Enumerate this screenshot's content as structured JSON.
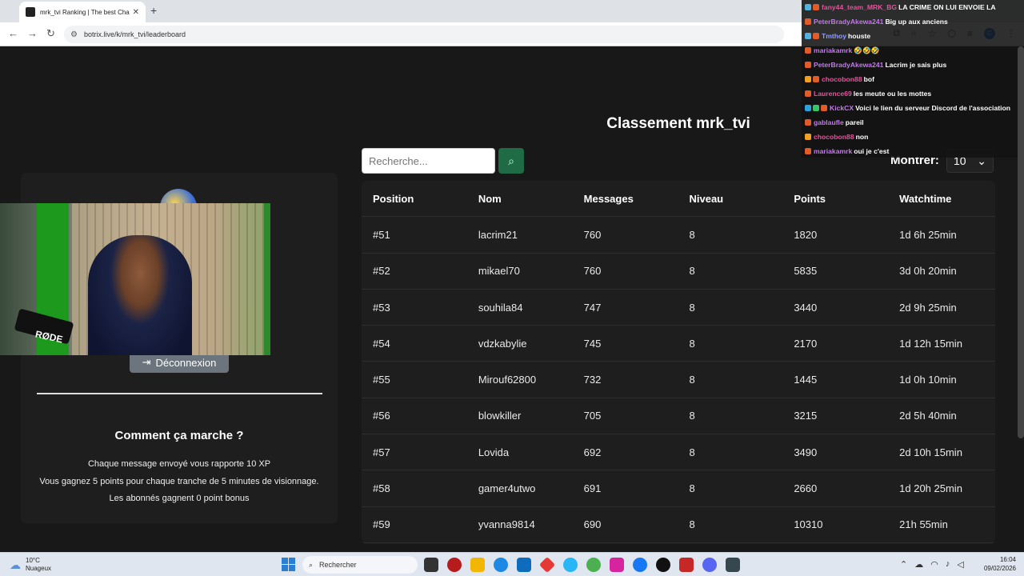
{
  "browser": {
    "tab_title": "mrk_tvi Ranking | The best Chat",
    "tab_close": "✕",
    "new_tab": "+",
    "url": "botrix.live/k/mrk_tvi/leaderboard",
    "profile_initial": "C"
  },
  "page": {
    "title": "Classement mrk_tvi",
    "search_placeholder": "Recherche...",
    "show_label": "Montrer:",
    "show_value": "10",
    "table": {
      "headers": [
        "Position",
        "Nom",
        "Messages",
        "Niveau",
        "Points",
        "Watchtime"
      ],
      "rows": [
        [
          "#51",
          "lacrim21",
          "760",
          "8",
          "1820",
          "1d 6h 25min"
        ],
        [
          "#52",
          "mikael70",
          "760",
          "8",
          "5835",
          "3d 0h 20min"
        ],
        [
          "#53",
          "souhila84",
          "747",
          "8",
          "3440",
          "2d 9h 25min"
        ],
        [
          "#54",
          "vdzkabylie",
          "745",
          "8",
          "2170",
          "1d 12h 15min"
        ],
        [
          "#55",
          "Mirouf62800",
          "732",
          "8",
          "1445",
          "1d 0h 10min"
        ],
        [
          "#56",
          "blowkiller",
          "705",
          "8",
          "3215",
          "2d 5h 40min"
        ],
        [
          "#57",
          "Lovida",
          "692",
          "8",
          "3490",
          "2d 10h 15min"
        ],
        [
          "#58",
          "gamer4utwo",
          "691",
          "8",
          "2660",
          "1d 20h 25min"
        ],
        [
          "#59",
          "yvanna9814",
          "690",
          "8",
          "10310",
          "21h 55min"
        ]
      ]
    }
  },
  "left_panel": {
    "logout_label": "Déconnexion",
    "how_title": "Comment ça marche ?",
    "how_lines": [
      "Chaque message envoyé vous rapporte 10 XP",
      "Vous gagnez 5 points pour chaque tranche de 5 minutes de visionnage.",
      "Les abonnés gagnent 0 point bonus"
    ]
  },
  "webcam": {
    "mic_brand": "RØDE"
  },
  "chat": [
    {
      "user": "fany44_team_MRK_BG",
      "color": "#e0559a",
      "msg": "LA CRIME ON LUI ENVOIE LA"
    },
    {
      "user": "PeterBradyAkewa241",
      "color": "#c07be6",
      "msg": "Big up aux anciens"
    },
    {
      "user": "Tmthoy",
      "color": "#8f9cff",
      "msg": "houste"
    },
    {
      "user": "mariakamrk",
      "color": "#c07be6",
      "msg": "🤣🤣🤣"
    },
    {
      "user": "PeterBradyAkewa241",
      "color": "#c07be6",
      "msg": "Lacrim je sais plus"
    },
    {
      "user": "chocobon88",
      "color": "#e0559a",
      "msg": "bof"
    },
    {
      "user": "Laurence69",
      "color": "#e0559a",
      "msg": "les meute ou les mottes"
    },
    {
      "user": "KickCX",
      "color": "#c07be6",
      "msg": "Voici le lien du serveur Discord de l'association"
    },
    {
      "user": "gablaufle",
      "color": "#c07be6",
      "msg": "pareil"
    },
    {
      "user": "chocobon88",
      "color": "#e0559a",
      "msg": "non"
    },
    {
      "user": "mariakamrk",
      "color": "#c07be6",
      "msg": "oui je c'est"
    }
  ],
  "taskbar": {
    "weather_temp": "10°C",
    "weather_desc": "Nuageux",
    "search_label": "Rechercher",
    "time": "16:04",
    "date": "09/02/2026"
  },
  "colors": {
    "page_bg": "#181818",
    "panel_bg": "#1e1e1e",
    "search_button": "#1f6b45",
    "logout_button": "#6c757d"
  }
}
